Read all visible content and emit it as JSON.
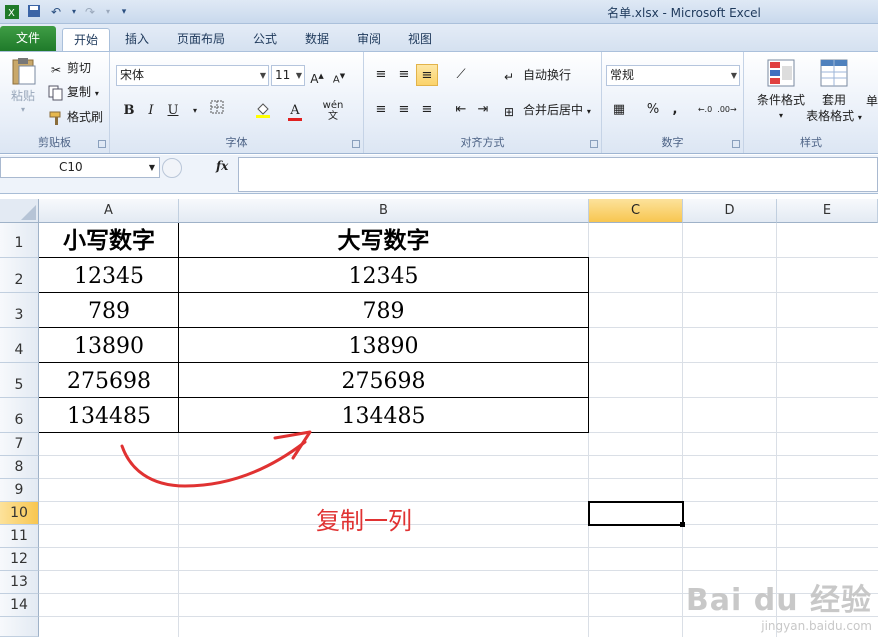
{
  "window": {
    "title": "名单.xlsx  -  Microsoft Excel"
  },
  "tabs": [
    {
      "label": "文件"
    },
    {
      "label": "开始"
    },
    {
      "label": "插入"
    },
    {
      "label": "页面布局"
    },
    {
      "label": "公式"
    },
    {
      "label": "数据"
    },
    {
      "label": "审阅"
    },
    {
      "label": "视图"
    }
  ],
  "ribbon": {
    "clipboard": {
      "group_label": "剪贴板",
      "paste": "粘贴",
      "cut": "剪切",
      "copy": "复制",
      "format_painter": "格式刷"
    },
    "font": {
      "group_label": "字体",
      "font_name": "宋体",
      "font_size": "11",
      "grow": "A",
      "shrink": "A",
      "bold": "B",
      "italic": "I",
      "underline": "U"
    },
    "alignment": {
      "group_label": "对齐方式",
      "wrap": "自动换行",
      "merge": "合并后居中"
    },
    "number": {
      "group_label": "数字",
      "format": "常规",
      "percent": "%",
      "comma": ","
    },
    "styles": {
      "group_label": "样式",
      "conditional": "条件格式",
      "table_line1": "套用",
      "table_line2": "表格格式",
      "cell_styles": "单"
    }
  },
  "formula_bar": {
    "name_box": "C10",
    "fx": "fx",
    "content": ""
  },
  "columns": [
    "A",
    "B",
    "C",
    "D",
    "E"
  ],
  "rows": [
    "1",
    "2",
    "3",
    "4",
    "5",
    "6",
    "7",
    "8",
    "9",
    "10",
    "11",
    "12",
    "13",
    "14"
  ],
  "table": {
    "headers": [
      "小写数字",
      "大写数字"
    ],
    "rows": [
      [
        "12345",
        "12345"
      ],
      [
        "789",
        "789"
      ],
      [
        "13890",
        "13890"
      ],
      [
        "275698",
        "275698"
      ],
      [
        "134485",
        "134485"
      ]
    ]
  },
  "annotation": {
    "text": "复制一列",
    "color": "#e03232"
  },
  "watermark": {
    "brand": "Bai du 经验",
    "url": "jingyan.baidu.com"
  },
  "colors": {
    "file_tab": "#2a8a35",
    "selected_header": "#f8c650",
    "accent": "#1e395b"
  }
}
